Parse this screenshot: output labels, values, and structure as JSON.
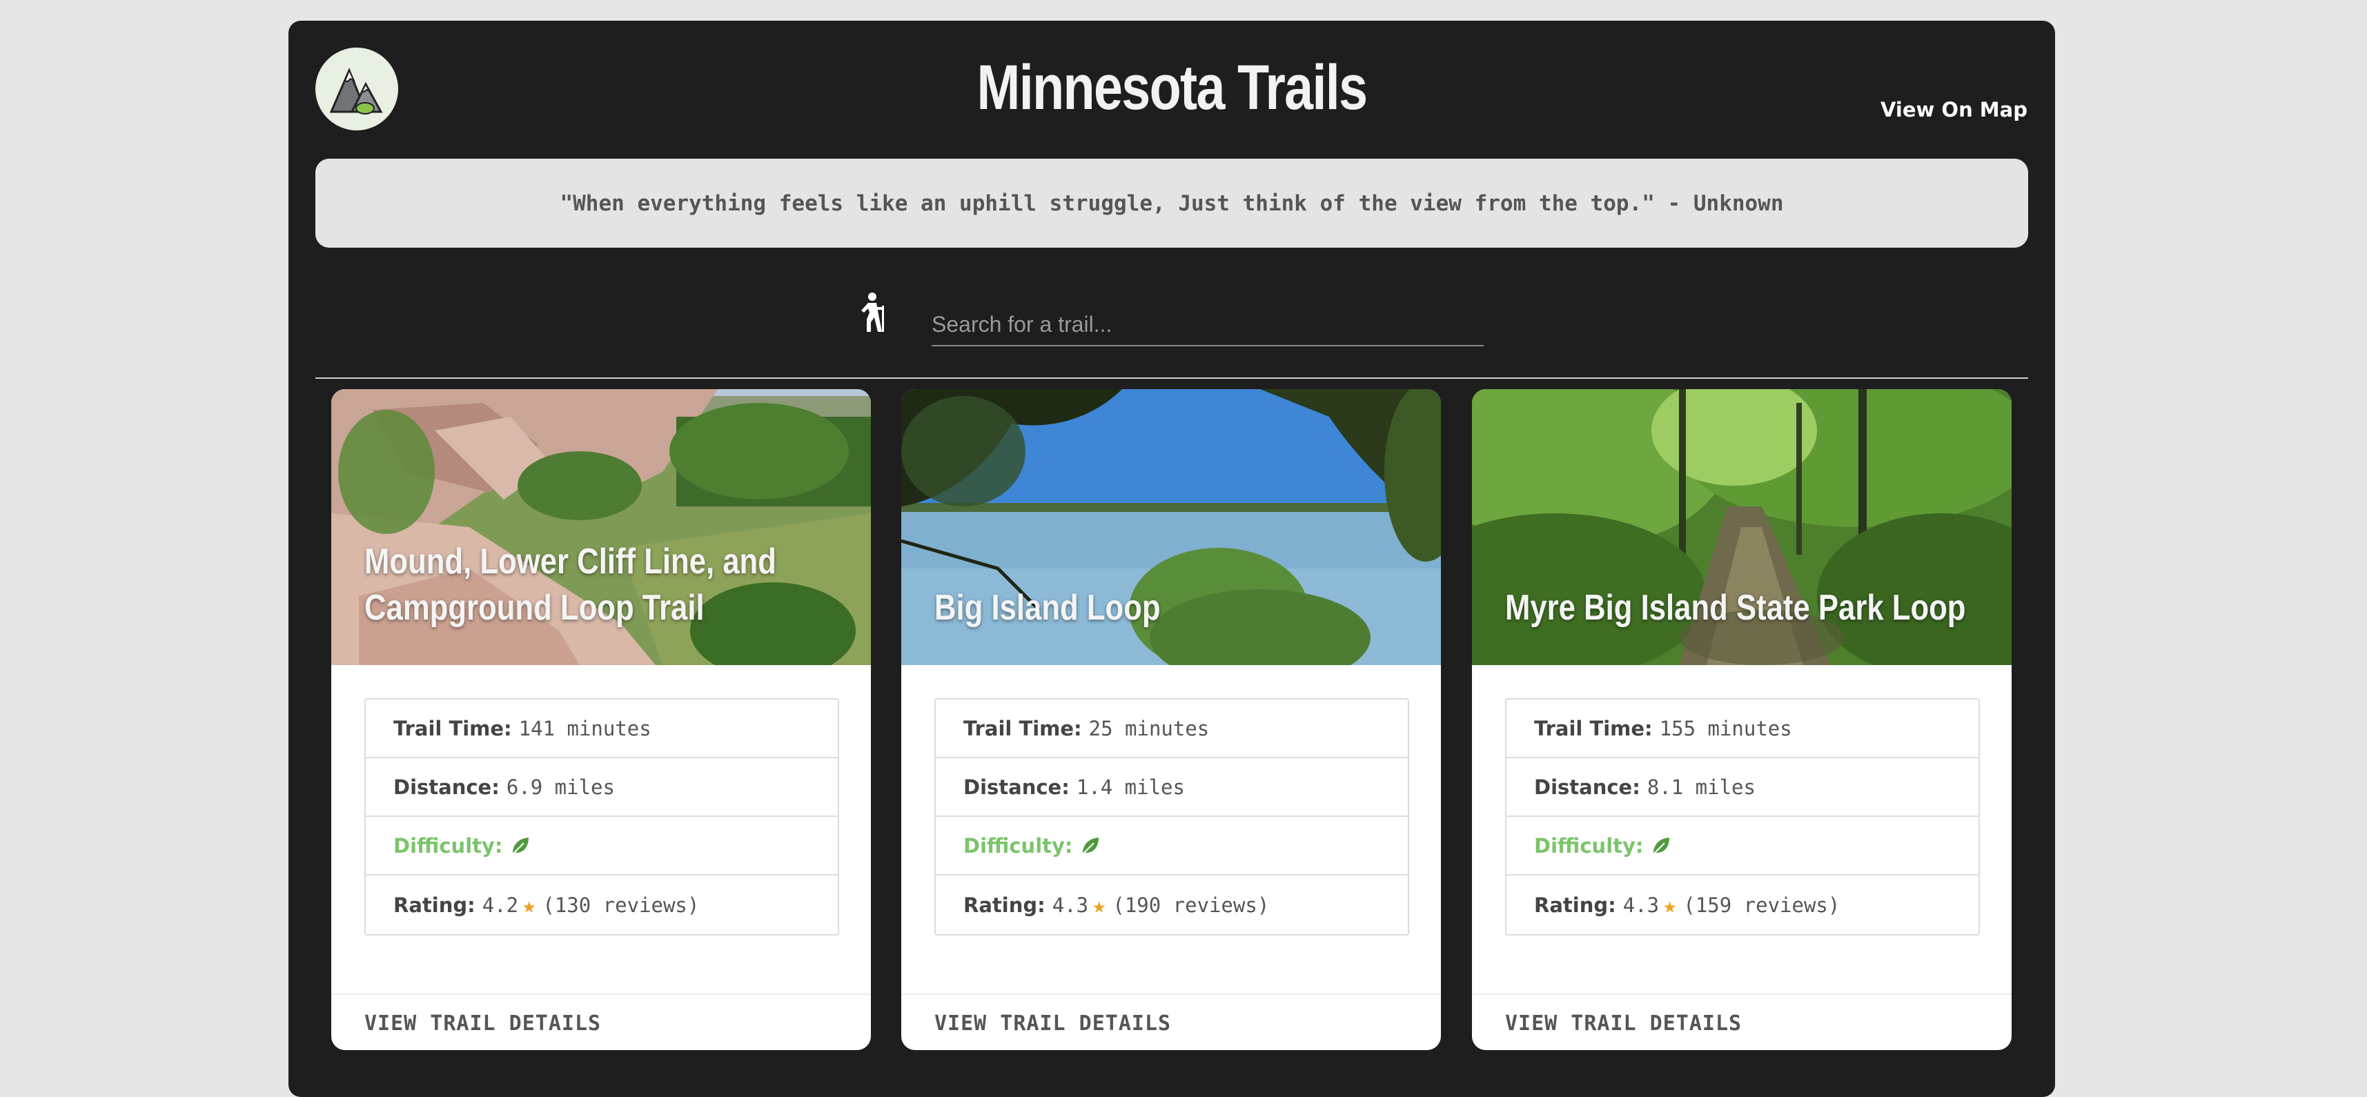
{
  "header": {
    "title": "Minnesota Trails",
    "map_link": "View On Map",
    "logo_icon": "mountain-logo-icon"
  },
  "quote": "\"When everything feels like an uphill struggle, Just think of the view from the top.\" - Unknown",
  "search": {
    "placeholder": "Search for a trail...",
    "icon": "hiker-icon"
  },
  "colors": {
    "app_bg": "#1e1e1e",
    "page_bg": "#e6e6e6",
    "difficulty_green": "#7bc46b",
    "star_orange": "#f0a020"
  },
  "trails": [
    {
      "name": "Mound, Lower Cliff Line, and Campground Loop Trail",
      "time_label": "Trail Time:",
      "time_value": "141 minutes",
      "distance_label": "Distance:",
      "distance_value": "6.9 miles",
      "difficulty_label": "Difficulty:",
      "difficulty_icon": "leaf-icon",
      "rating_label": "Rating:",
      "rating_value": "4.2",
      "reviews": "(130 reviews)",
      "details_link": "VIEW TRAIL DETAILS"
    },
    {
      "name": "Big Island Loop",
      "time_label": "Trail Time:",
      "time_value": "25 minutes",
      "distance_label": "Distance:",
      "distance_value": "1.4 miles",
      "difficulty_label": "Difficulty:",
      "difficulty_icon": "leaf-icon",
      "rating_label": "Rating:",
      "rating_value": "4.3",
      "reviews": "(190 reviews)",
      "details_link": "VIEW TRAIL DETAILS"
    },
    {
      "name": "Myre Big Island State Park Loop",
      "time_label": "Trail Time:",
      "time_value": "155 minutes",
      "distance_label": "Distance:",
      "distance_value": "8.1 miles",
      "difficulty_label": "Difficulty:",
      "difficulty_icon": "leaf-icon",
      "rating_label": "Rating:",
      "rating_value": "4.3",
      "reviews": "(159 reviews)",
      "details_link": "VIEW TRAIL DETAILS"
    }
  ]
}
